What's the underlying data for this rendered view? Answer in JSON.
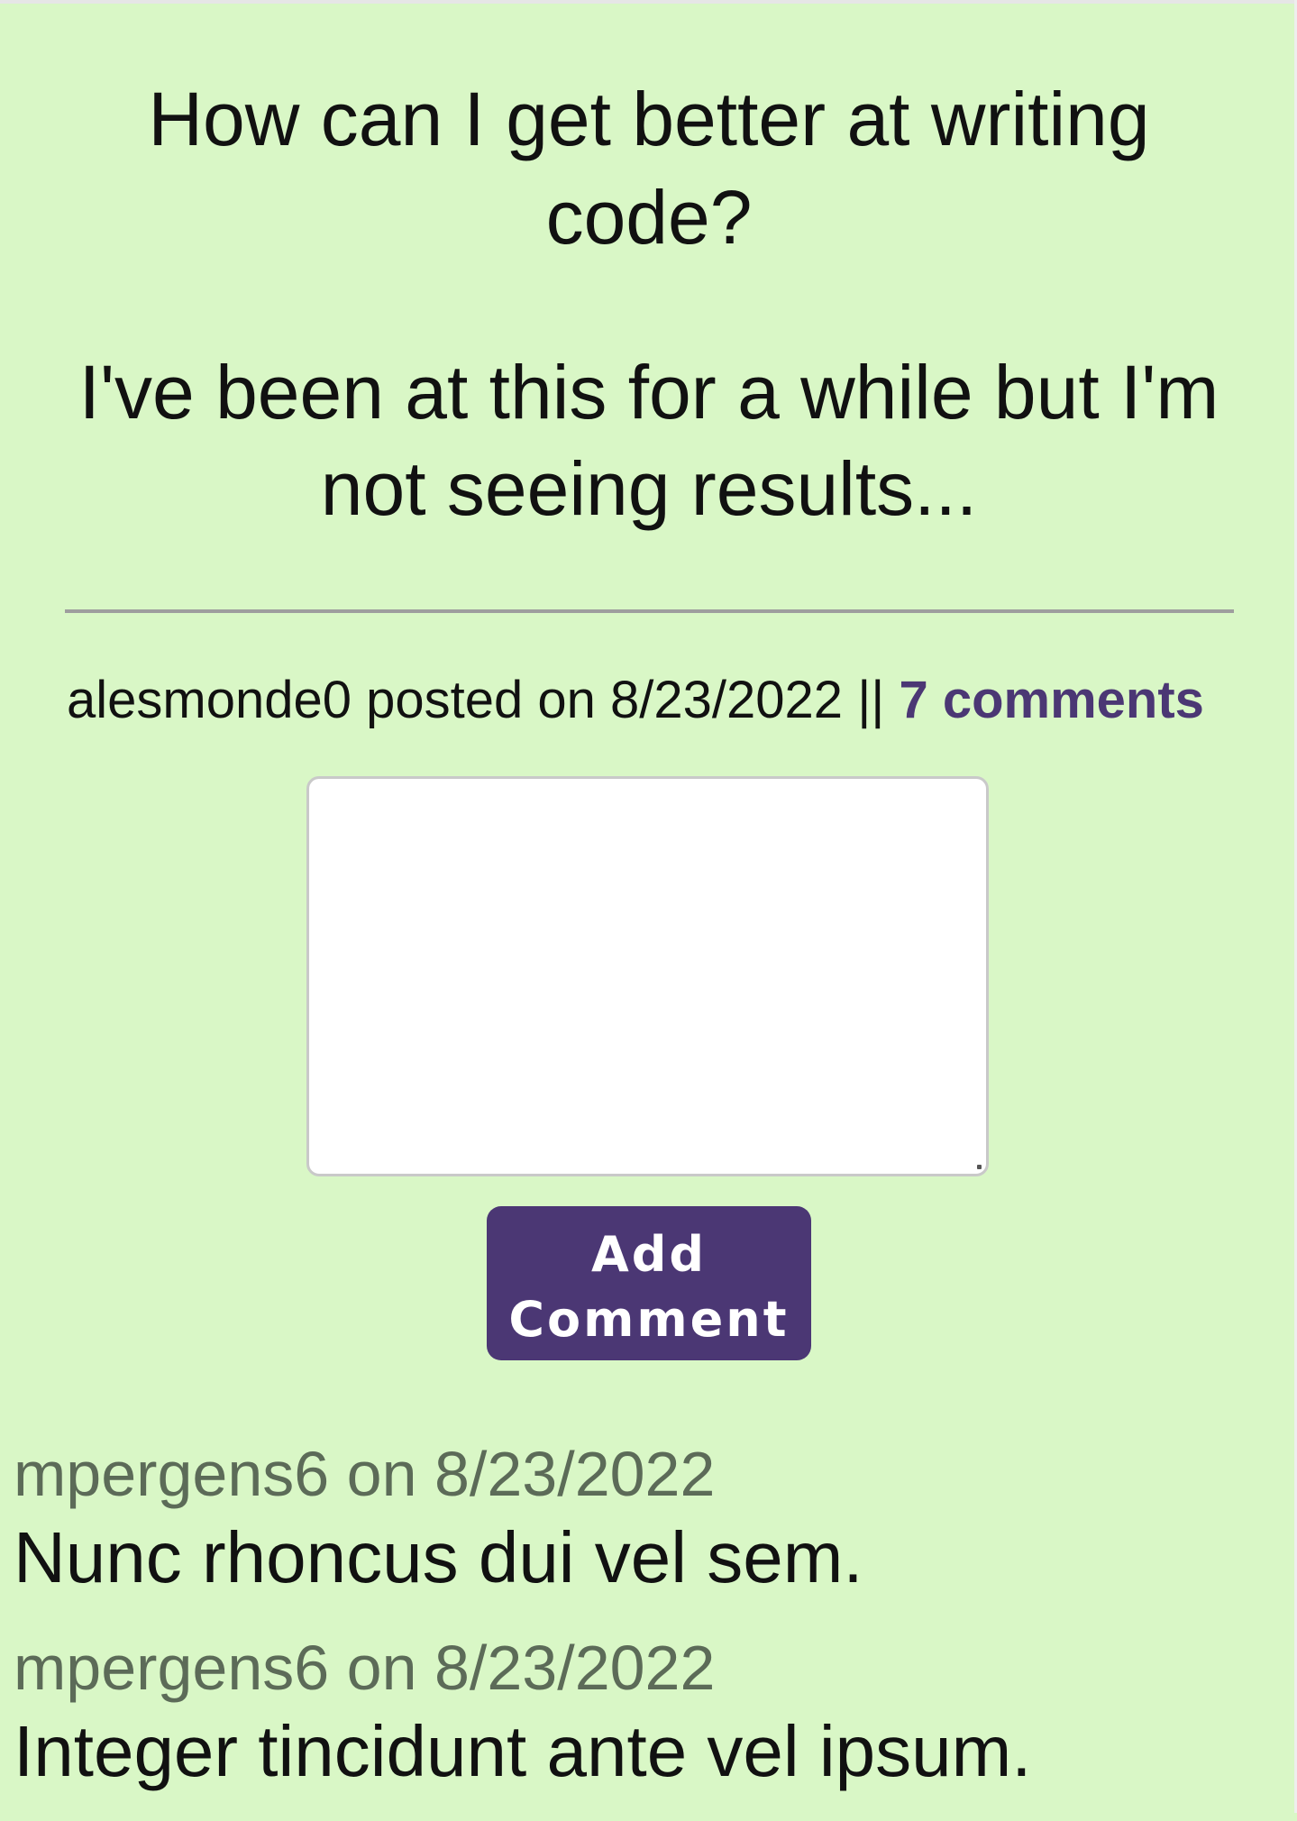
{
  "post": {
    "title": "How can I get better at writing code?",
    "body": "I've been at this for a while but I'm not seeing results...",
    "author": "alesmonde0",
    "posted_label": "posted on",
    "date": "8/23/2022",
    "separator": "||",
    "comments_link": "7 comments"
  },
  "comment_form": {
    "value": "",
    "button_label": "Add Comment"
  },
  "comments": [
    {
      "author": "mpergens6",
      "on_label": "on",
      "date": "8/23/2022",
      "text": "Nunc rhoncus dui vel sem."
    },
    {
      "author": "mpergens6",
      "on_label": "on",
      "date": "8/23/2022",
      "text": "Integer tincidunt ante vel ipsum."
    }
  ],
  "colors": {
    "page_background": "#d9f7c6",
    "accent": "#4b3774",
    "comment_meta": "#5c6b58",
    "divider": "#9e9e9e"
  }
}
